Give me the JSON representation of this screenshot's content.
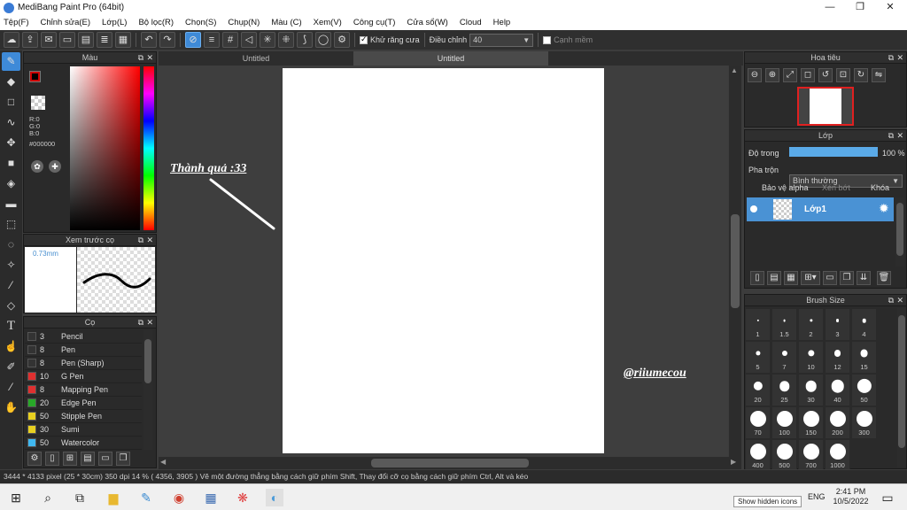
{
  "window": {
    "title": "MediBang Paint Pro (64bit)",
    "minimize": "—",
    "maximize": "❐",
    "close": "✕"
  },
  "menu": [
    "Tệp(F)",
    "Chỉnh sửa(E)",
    "Lớp(L)",
    "Bộ lọc(R)",
    "Chọn(S)",
    "Chụp(N)",
    "Màu (C)",
    "Xem(V)",
    "Công cụ(T)",
    "Cửa sổ(W)",
    "Cloud",
    "Help"
  ],
  "toolbar": {
    "antialias_label": "Khử răng cưa",
    "antialias_checked": true,
    "adjust_label": "Điều chỉnh",
    "adjust_value": "40",
    "edge_label": "Cạnh mềm",
    "edge_checked": false
  },
  "color_panel": {
    "title": "Màu",
    "r": "R:0",
    "g": "G:0",
    "b": "B:0",
    "hex": "#000000",
    "primary": "#000000",
    "secondary": "#ffffff"
  },
  "preview_panel": {
    "title": "Xem trước cọ",
    "size": "0.73mm"
  },
  "brush_panel": {
    "title": "Cọ",
    "items": [
      {
        "size": "3",
        "name": "Pencil",
        "color": "#333333"
      },
      {
        "size": "8",
        "name": "Pen",
        "color": "#333333"
      },
      {
        "size": "8",
        "name": "Pen (Sharp)",
        "color": "#333333"
      },
      {
        "size": "10",
        "name": "G Pen",
        "color": "#e03030"
      },
      {
        "size": "8",
        "name": "Mapping Pen",
        "color": "#e03030"
      },
      {
        "size": "20",
        "name": "Edge Pen",
        "color": "#28a828"
      },
      {
        "size": "50",
        "name": "Stipple Pen",
        "color": "#e8d020"
      },
      {
        "size": "30",
        "name": "Sumi",
        "color": "#e8d020"
      },
      {
        "size": "50",
        "name": "Watercolor",
        "color": "#40b8f0"
      }
    ]
  },
  "tabs": [
    {
      "label": "Untitled"
    },
    {
      "label": "Untitled"
    }
  ],
  "canvas": {
    "caption": "Thành quả :33",
    "signature": "@riiumecou"
  },
  "navigator_panel": {
    "title": "Hoa tiêu"
  },
  "layer_panel": {
    "title": "Lớp",
    "opacity_label": "Độ trong",
    "opacity_value": "100 %",
    "opacity": 1.0,
    "blend_label": "Pha trộn",
    "blend_value": "Bình thường",
    "protect_alpha": "Bảo vệ alpha",
    "clip": "Xén bớt",
    "lock": "Khóa",
    "layer_name": "Lớp1"
  },
  "brush_size_panel": {
    "title": "Brush Size",
    "sizes": [
      "1",
      "1.5",
      "2",
      "3",
      "4",
      "5",
      "7",
      "10",
      "12",
      "15",
      "20",
      "25",
      "30",
      "40",
      "50",
      "70",
      "100",
      "150",
      "200",
      "300",
      "400",
      "500",
      "700",
      "1000"
    ]
  },
  "status": "3444 * 4133 pixel   (25 * 30cm)   350 dpi   14 %   ( 4356, 3905 )   Vẽ một đường thẳng bằng cách giữ phím Shift, Thay đổi cỡ cọ bằng cách giữ phím Ctrl, Alt và kéo",
  "taskbar": {
    "lang": "ENG",
    "time": "2:41 PM",
    "date": "10/5/2022",
    "tooltip": "Show hidden icons"
  }
}
